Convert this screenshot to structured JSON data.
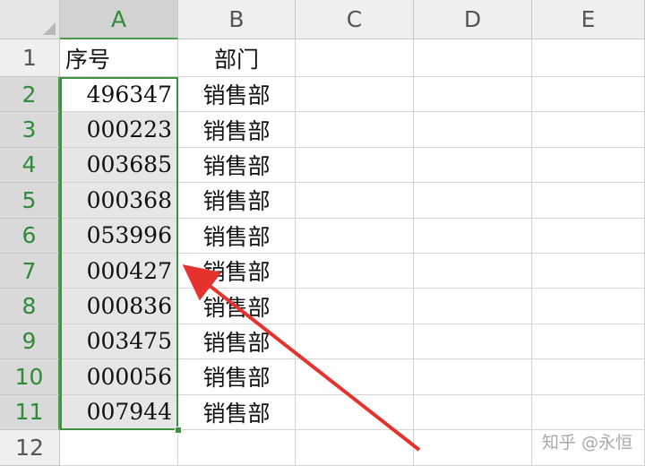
{
  "columns": [
    "A",
    "B",
    "C",
    "D",
    "E"
  ],
  "rows": [
    "1",
    "2",
    "3",
    "4",
    "5",
    "6",
    "7",
    "8",
    "9",
    "10",
    "11",
    "12"
  ],
  "cells": {
    "A1": "序号",
    "B1": "部门",
    "A2": "496347",
    "B2": "销售部",
    "A3": "000223",
    "B3": "销售部",
    "A4": "003685",
    "B4": "销售部",
    "A5": "000368",
    "B5": "销售部",
    "A6": "053996",
    "B6": "销售部",
    "A7": "000427",
    "B7": "销售部",
    "A8": "000836",
    "B8": "销售部",
    "A9": "003475",
    "B9": "销售部",
    "A10": "000056",
    "B10": "销售部",
    "A11": "007944",
    "B11": "销售部"
  },
  "selection": "A2:A11",
  "colors": {
    "selection": "#3f9142",
    "arrow": "#e5322d"
  },
  "watermark": "知乎 @永恒"
}
